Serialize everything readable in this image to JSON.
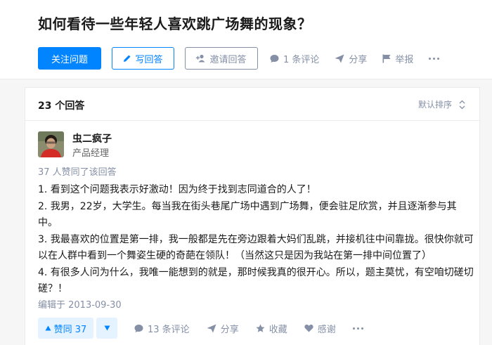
{
  "question": {
    "title": "如何看待一些年轻人喜欢跳广场舞的现象？"
  },
  "actions": {
    "follow": "关注问题",
    "write": "写回答",
    "invite": "邀请回答",
    "comments": "1 条评论",
    "share": "分享",
    "report": "举报"
  },
  "list": {
    "count": "23 个回答",
    "sort": "默认排序"
  },
  "answer": {
    "author_name": "虫二疯子",
    "author_bio": "产品经理",
    "votes_line": "37 人赞同了该回答",
    "paragraphs": [
      "1. 看到这个问题我表示好激动！因为终于找到志同道合的人了！",
      "2. 我男，22岁，大学生。每当我在街头巷尾广场中遇到广场舞，便会驻足欣赏，并且逐渐参与其中。",
      "3. 我最喜欢的位置是第一排，我一般都是先在旁边跟着大妈们乱跳，并接机往中间靠拢。很快你就可以在人群中看到一个舞姿生硬的奇葩在领队！（当然这只是因为我站在第一排中间位置了）",
      "4. 有很多人问为什么，我唯一能想到的就是，那时候我真的很开心。所以，题主莫忧，有空咱切磋切磋？！"
    ],
    "edited": "编辑于 2013-09-30",
    "upvote_label": "赞同 37",
    "comments": "13 条评论",
    "share": "分享",
    "collect": "收藏",
    "thanks": "感谢"
  },
  "colors": {
    "brand": "#0084ff",
    "meta": "#8590a6"
  }
}
